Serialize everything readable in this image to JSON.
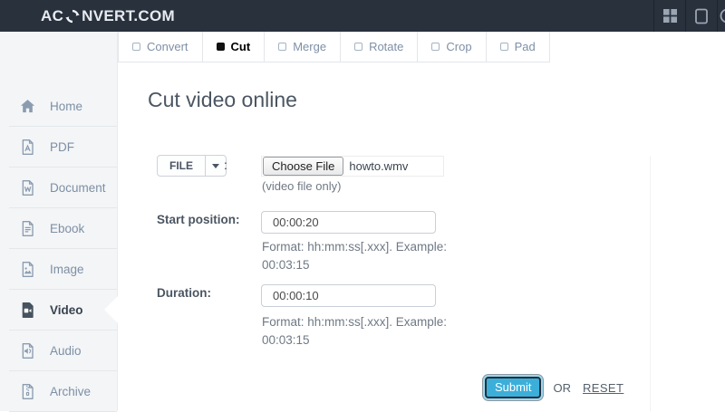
{
  "colors": {
    "header_bg": "#29313d",
    "accent": "#3bafda",
    "sidebar_bg": "#f3f5f7",
    "inactive_text": "#7e90a6",
    "dark_text": "#4b5662"
  },
  "header": {
    "logo_prefix": "AC",
    "logo_suffix": "NVERT.COM",
    "logo_icon": "sync-circle-icon",
    "right_icons": [
      "apps-grid-icon",
      "tablet-icon",
      "circle-icon"
    ]
  },
  "tabs": [
    {
      "label": "Convert",
      "active": false
    },
    {
      "label": "Cut",
      "active": true
    },
    {
      "label": "Merge",
      "active": false
    },
    {
      "label": "Rotate",
      "active": false
    },
    {
      "label": "Crop",
      "active": false
    },
    {
      "label": "Pad",
      "active": false
    }
  ],
  "sidebar": {
    "items": [
      {
        "label": "Home",
        "icon": "home-icon",
        "active": false
      },
      {
        "label": "PDF",
        "icon": "pdf-file-icon",
        "active": false
      },
      {
        "label": "Document",
        "icon": "word-file-icon",
        "active": false
      },
      {
        "label": "Ebook",
        "icon": "ebook-file-icon",
        "active": false
      },
      {
        "label": "Image",
        "icon": "image-file-icon",
        "active": false
      },
      {
        "label": "Video",
        "icon": "video-file-icon",
        "active": true
      },
      {
        "label": "Audio",
        "icon": "audio-file-icon",
        "active": false
      },
      {
        "label": "Archive",
        "icon": "archive-file-icon",
        "active": false
      }
    ]
  },
  "main": {
    "title": "Cut video online",
    "file_row": {
      "file_button": "FILE",
      "separator": ":",
      "choose_file_label": "Choose File",
      "filename": "howto.wmv",
      "hint": "(video file only)"
    },
    "fields": [
      {
        "label": "Start position:",
        "value": "00:00:20",
        "hint": "Format: hh:mm:ss[.xxx]. Example: 00:03:15"
      },
      {
        "label": "Duration:",
        "value": "00:00:10",
        "hint": "Format: hh:mm:ss[.xxx]. Example: 00:03:15"
      }
    ],
    "actions": {
      "submit_label": "Submit",
      "or_label": "OR",
      "reset_label": "RESET"
    }
  }
}
